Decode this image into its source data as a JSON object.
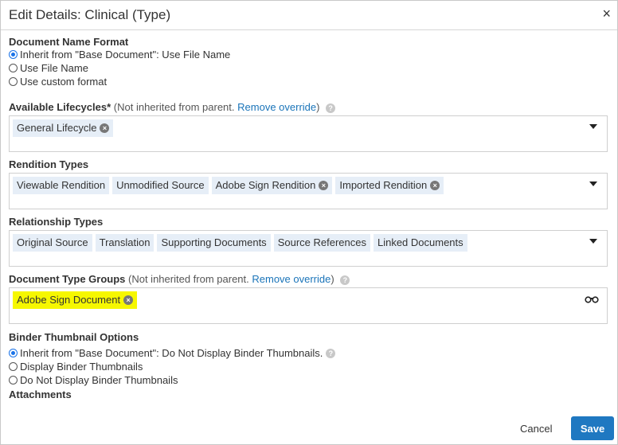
{
  "dialog": {
    "title": "Edit Details: Clinical (Type)",
    "close_label": "×"
  },
  "document_name_format": {
    "label": "Document Name Format",
    "options": [
      {
        "label": "Inherit from \"Base Document\": Use File Name",
        "checked": true
      },
      {
        "label": "Use File Name",
        "checked": false
      },
      {
        "label": "Use custom format",
        "checked": false
      }
    ]
  },
  "available_lifecycles": {
    "label": "Available Lifecycles*",
    "note": "(Not inherited from parent.",
    "link": "Remove override",
    "note_close": ")",
    "chips": [
      "General Lifecycle"
    ]
  },
  "rendition_types": {
    "label": "Rendition Types",
    "chips": [
      "Viewable Rendition",
      "Unmodified Source",
      "Adobe Sign Rendition",
      "Imported Rendition"
    ]
  },
  "relationship_types": {
    "label": "Relationship Types",
    "chips": [
      "Original Source",
      "Translation",
      "Supporting Documents",
      "Source References",
      "Linked Documents"
    ]
  },
  "document_type_groups": {
    "label": "Document Type Groups",
    "note": "(Not inherited from parent.",
    "link": "Remove override",
    "note_close": ")",
    "chips": [
      "Adobe Sign Document"
    ]
  },
  "binder_thumbnail_options": {
    "label": "Binder Thumbnail Options",
    "options": [
      {
        "label": "Inherit from \"Base Document\": Do Not Display Binder Thumbnails.",
        "checked": true
      },
      {
        "label": "Display Binder Thumbnails",
        "checked": false
      },
      {
        "label": "Do Not Display Binder Thumbnails",
        "checked": false
      }
    ]
  },
  "attachments": {
    "label": "Attachments"
  },
  "footer": {
    "cancel_label": "Cancel",
    "save_label": "Save"
  },
  "colors": {
    "accent": "#1f78c1",
    "highlight": "#f6f700",
    "chip_bg": "#e6eef7"
  }
}
